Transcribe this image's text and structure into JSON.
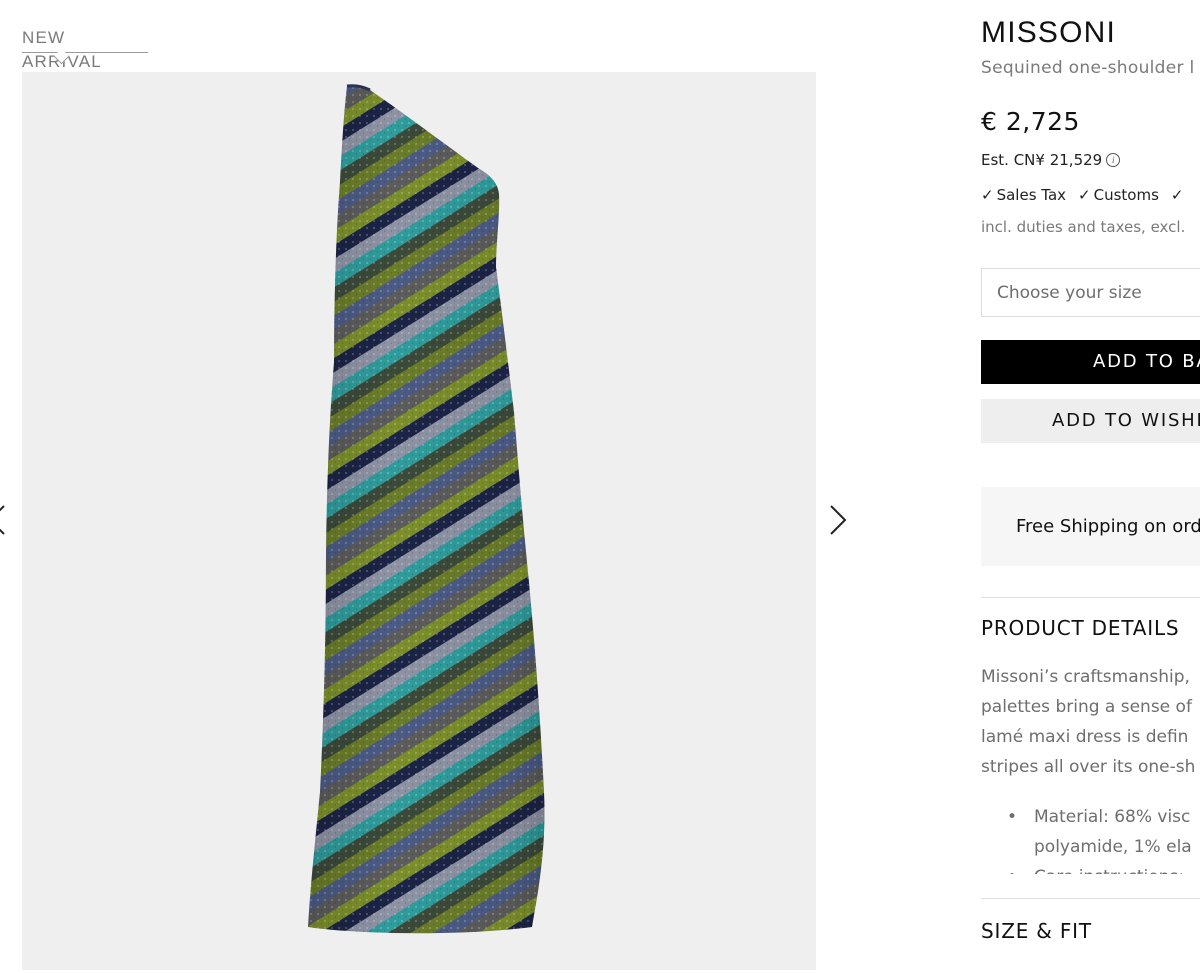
{
  "badge": {
    "label": "NEW ARRIVAL"
  },
  "gallery": {
    "prev_icon": "chevron-left-icon",
    "next_icon": "chevron-right-icon"
  },
  "product": {
    "brand": "MISSONI",
    "name": "Sequined one-shoulder l",
    "price": "€ 2,725",
    "est_price": "Est. CN¥ 21,529",
    "tax_items": [
      "Sales Tax",
      "Customs",
      ""
    ],
    "duties_note": "incl. duties and taxes, excl."
  },
  "actions": {
    "size_placeholder": "Choose your size",
    "add_to_bag": "ADD TO BA",
    "add_to_wishlist": "ADD TO WISHL"
  },
  "shipping": {
    "text": "Free Shipping on ord"
  },
  "details": {
    "title": "PRODUCT DETAILS",
    "lines": [
      "Missoni’s craftsmanship,",
      "palettes bring a sense of",
      "lamé maxi dress is defin",
      "stripes all over its one-sh"
    ],
    "bullets": [
      "Material: 68% visc",
      "polyamide, 1% ela",
      "Care instructions:"
    ]
  },
  "size_fit": {
    "title": "SIZE & FIT"
  },
  "colors": {
    "gallery_bg": "#efefef",
    "bag_button": "#000000",
    "wishlist_button": "#eeeeee"
  }
}
